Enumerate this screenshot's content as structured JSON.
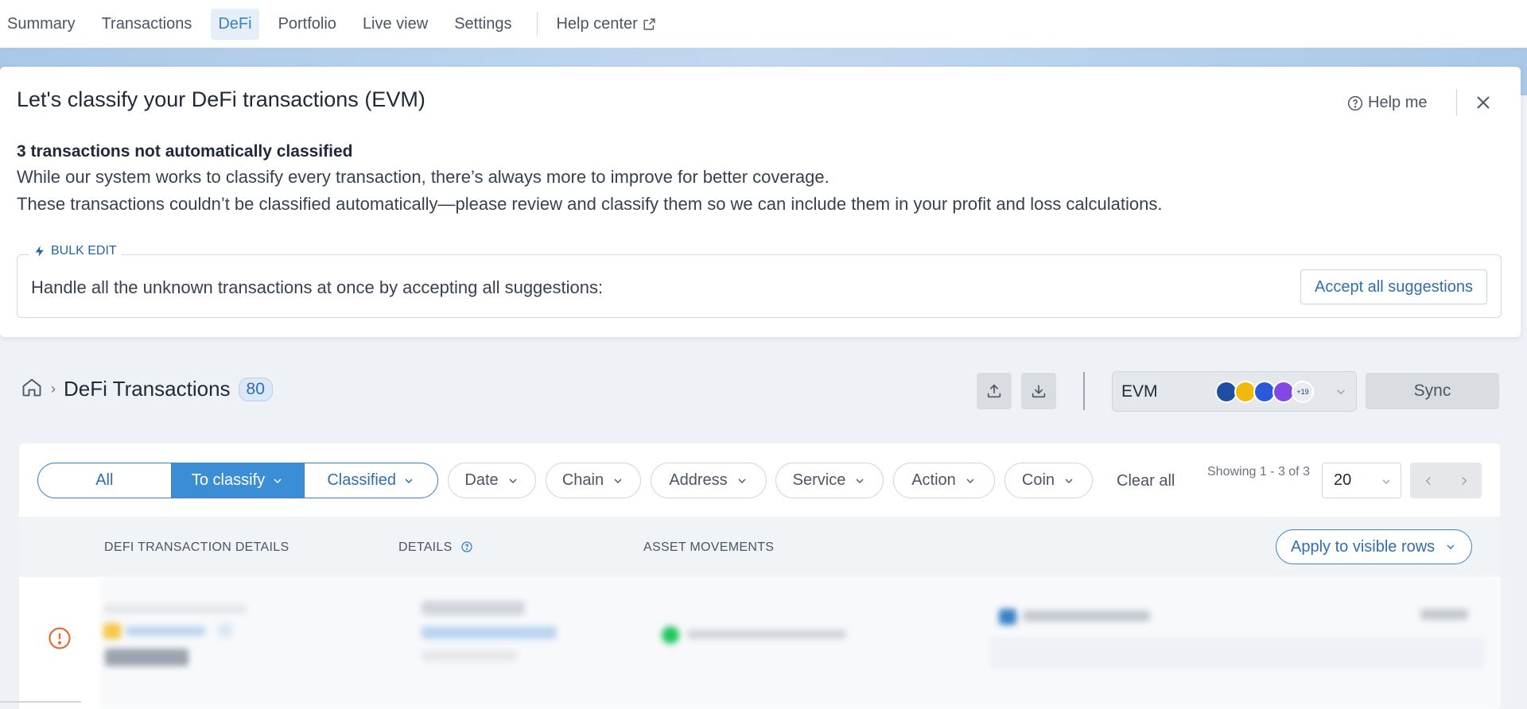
{
  "nav": {
    "items": [
      "Summary",
      "Transactions",
      "DeFi",
      "Portfolio",
      "Live view",
      "Settings"
    ],
    "active": "DeFi",
    "help": "Help center"
  },
  "classify": {
    "title": "Let's classify your DeFi transactions (EVM)",
    "help_me": "Help me",
    "bold": "3 transactions not automatically classified",
    "line1": "While our system works to classify every transaction, there’s always more to improve for better coverage.",
    "line2": "These transactions couldn’t be classified automatically—please review and classify them so we can include them in your profit and loss calculations.",
    "bulk_tag": "BULK EDIT",
    "bulk_text": "Handle all the unknown transactions at once by accepting all suggestions:",
    "accept_button": "Accept all suggestions"
  },
  "breadcrumb": {
    "title": "DeFi Transactions",
    "count": "80"
  },
  "chain_select": {
    "label": "EVM",
    "more": "+19",
    "icon_colors": [
      "#1f4fa3",
      "#f0b90b",
      "#2a5ada",
      "#8247e5",
      "#e8edf3"
    ]
  },
  "sync_button": "Sync",
  "filters": {
    "segments": [
      "All",
      "To classify",
      "Classified"
    ],
    "active_segment": "To classify",
    "chips": [
      "Date",
      "Chain",
      "Address",
      "Service",
      "Action",
      "Coin"
    ],
    "clear_all": "Clear all",
    "showing": "Showing 1 - 3 of 3",
    "page_size": "20"
  },
  "table": {
    "headers": [
      "DEFI TRANSACTION DETAILS",
      "DETAILS",
      "ASSET MOVEMENTS"
    ],
    "apply_button": "Apply to visible rows"
  },
  "colors": {
    "accent": "#3b82c4",
    "warning": "#e0703a"
  }
}
